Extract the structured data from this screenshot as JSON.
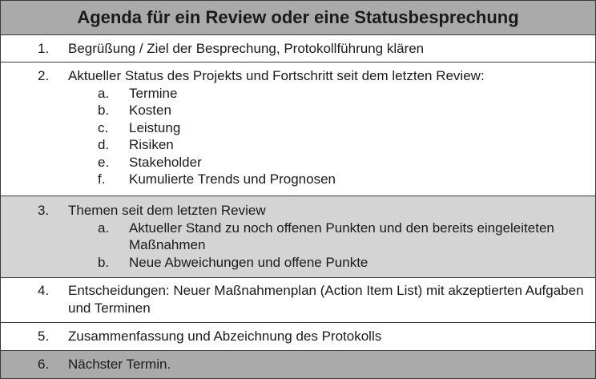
{
  "title": "Agenda für ein Review oder eine Statusbesprechung",
  "items": [
    {
      "number": "1.",
      "text": "Begrüßung / Ziel der Besprechung, Protokollführung klären",
      "subitems": []
    },
    {
      "number": "2.",
      "text": "Aktueller Status des Projekts und Fortschritt seit dem letzten Review:",
      "subitems": [
        {
          "letter": "a.",
          "text": "Termine"
        },
        {
          "letter": "b.",
          "text": "Kosten"
        },
        {
          "letter": "c.",
          "text": "Leistung"
        },
        {
          "letter": "d.",
          "text": "Risiken"
        },
        {
          "letter": "e.",
          "text": "Stakeholder"
        },
        {
          "letter": "f.",
          "text": "Kumulierte Trends und Prognosen"
        }
      ]
    },
    {
      "number": "3.",
      "text": "Themen seit dem letzten Review",
      "subitems": [
        {
          "letter": "a.",
          "text": "Aktueller Stand zu noch offenen Punkten und den bereits eingeleiteten Maßnahmen"
        },
        {
          "letter": "b.",
          "text": "Neue Abweichungen und offene Punkte"
        }
      ]
    },
    {
      "number": "4.",
      "text": "Entscheidungen: Neuer Maßnahmenplan (Action Item List) mit akzeptierten Aufgaben und Terminen",
      "subitems": []
    },
    {
      "number": "5.",
      "text": "Zusammenfassung und Abzeichnung des Protokolls",
      "subitems": []
    },
    {
      "number": "6.",
      "text": "Nächster Termin.",
      "subitems": []
    }
  ],
  "colors": {
    "header_background": "#aaaaaa",
    "white_row": "#ffffff",
    "light_grey_row": "#d4d4d4",
    "dark_grey_row": "#aaaaaa",
    "border": "#3a3a3a"
  }
}
